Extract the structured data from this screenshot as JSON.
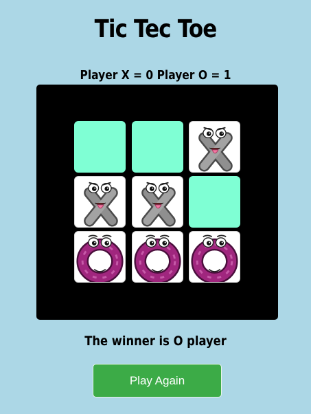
{
  "game": {
    "title": "Tic Tec Toe",
    "score_text": "Player X = 0 Player O = 1",
    "winner_text": "The winner is O player",
    "play_again_label": "Play Again"
  },
  "board": {
    "cells": [
      "",
      "",
      "X",
      "X",
      "X",
      "",
      "O",
      "O",
      "O"
    ]
  },
  "colors": {
    "background": "#acd7e6",
    "board": "#000000",
    "empty_cell": "#7fffd4",
    "button": "#3cab47",
    "x_piece": "#8a8a8a",
    "o_piece": "#a0267e"
  },
  "icons": {
    "X": "cartoon-x-icon",
    "O": "cartoon-o-icon"
  }
}
